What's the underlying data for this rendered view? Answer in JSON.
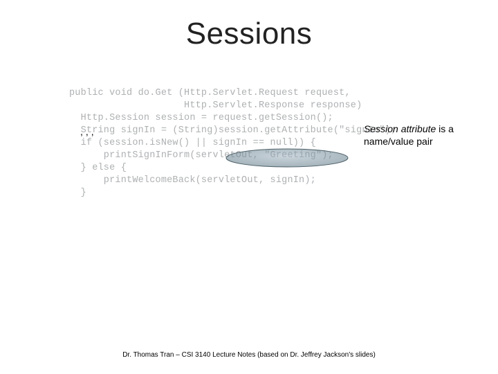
{
  "title": "Sessions",
  "ellipsis": ",,,",
  "annotation": {
    "italic": "Session attribute",
    "rest": " is a name/value pair"
  },
  "code": {
    "l1": "public void do.Get (Http.Servlet.Request request,",
    "l2": "                    Http.Servlet.Response response)",
    "l3": "",
    "l4": "",
    "l5": "  Http.Session session = request.getSession();",
    "l6": "  String signIn = (String)session.getAttribute(\"signIn\");",
    "l7": "  if (session.isNew() || signIn == null)) {",
    "l8": "      printSignInForm(servletOut, \"Greeting\");",
    "l9": "  } else {",
    "l10": "      printWelcomeBack(servletOut, signIn);",
    "l11": "  }"
  },
  "footer": "Dr. Thomas Tran – CSI 3140 Lecture Notes (based on Dr. Jeffrey Jackson's slides)"
}
